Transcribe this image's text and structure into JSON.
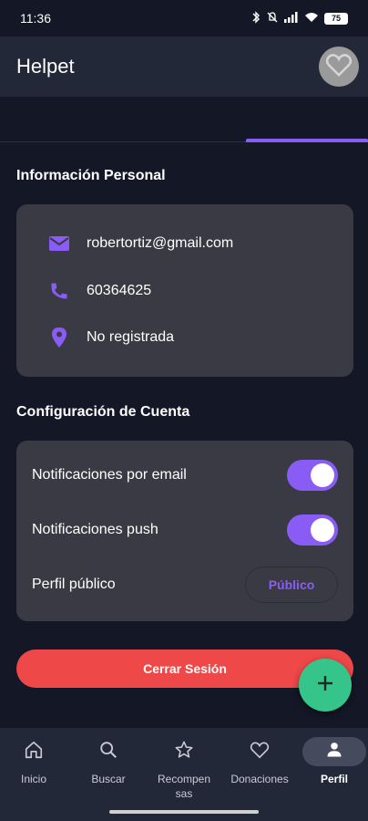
{
  "status_bar": {
    "time": "11:36",
    "battery": "75"
  },
  "app_bar": {
    "title": "Helpet"
  },
  "personal_info": {
    "title": "Información Personal",
    "email": "robertortiz@gmail.com",
    "phone": "60364625",
    "address": "No registrada"
  },
  "account_settings": {
    "title": "Configuración de Cuenta",
    "email_notifications": {
      "label": "Notificaciones por email",
      "enabled": true
    },
    "push_notifications": {
      "label": "Notificaciones push",
      "enabled": true
    },
    "public_profile": {
      "label": "Perfil público",
      "button": "Público"
    }
  },
  "logout_label": "Cerrar Sesión",
  "bottom_nav": {
    "items": [
      {
        "label": "Inicio",
        "icon": "home-icon"
      },
      {
        "label": "Buscar",
        "icon": "search-icon"
      },
      {
        "label": "Recompensas",
        "icon": "star-icon"
      },
      {
        "label": "Donaciones",
        "icon": "heart-icon"
      },
      {
        "label": "Perfil",
        "icon": "person-icon"
      }
    ],
    "active": "Perfil"
  },
  "colors": {
    "accent": "#8a5cf6",
    "danger": "#ef4848",
    "fab": "#35c489",
    "card": "#3a3a44",
    "background": "#141726"
  }
}
